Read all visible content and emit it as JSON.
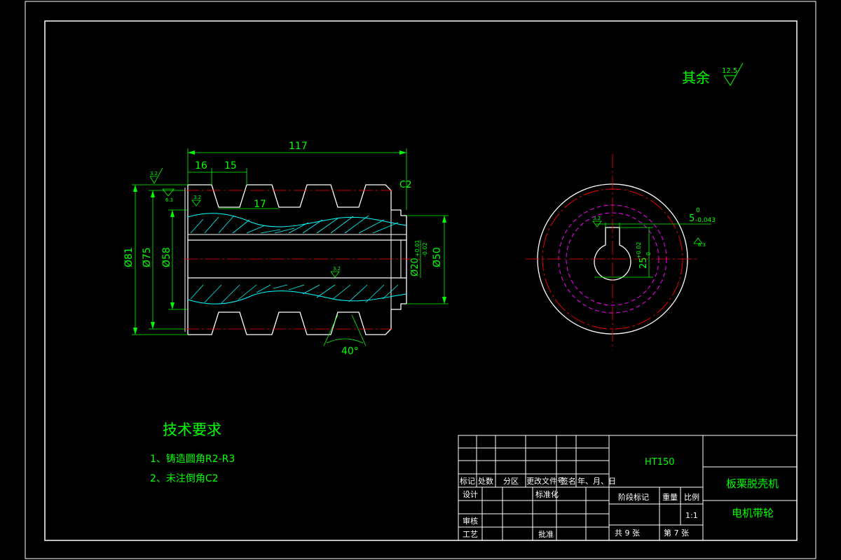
{
  "roughness": {
    "label": "其余",
    "value": "12.5"
  },
  "dims": {
    "overall_length": "117",
    "d16": "16",
    "d15": "15",
    "d17": "17",
    "dia81": "Ø81",
    "dia75": "Ø75",
    "dia58": "Ø58",
    "dia20": "Ø20",
    "tol20": "+0.01",
    "tol20b": "-0.02",
    "dia50": "Ø50",
    "angle": "40°",
    "c2": "C2",
    "c2b": "C2",
    "key_w": "5",
    "key_w_tol": "-0.043",
    "key_w_tol_up": "0",
    "key_h": "25",
    "key_h_tol": "+0.02",
    "key_h_tol_dn": "0",
    "r32": "3.2",
    "r63": "6.3"
  },
  "tech": {
    "title": "技术要求",
    "items": [
      "1、铸造圆角R2-R3",
      "2、未注倒角C2"
    ]
  },
  "titleblock": {
    "material": "HT150",
    "machine": "板栗脱壳机",
    "part": "电机带轮",
    "headers": [
      "标记",
      "处数",
      "分区",
      "更改文件号",
      "签名",
      "年、月、日"
    ],
    "design": "设计",
    "standard": "标准化",
    "stage": "阶段标记",
    "weight": "重量",
    "scale_label": "比例",
    "scale": "1:1",
    "review": "审核",
    "process": "工艺",
    "approve": "批准",
    "total": "共  9  张",
    "sheet": "第  7  张"
  }
}
